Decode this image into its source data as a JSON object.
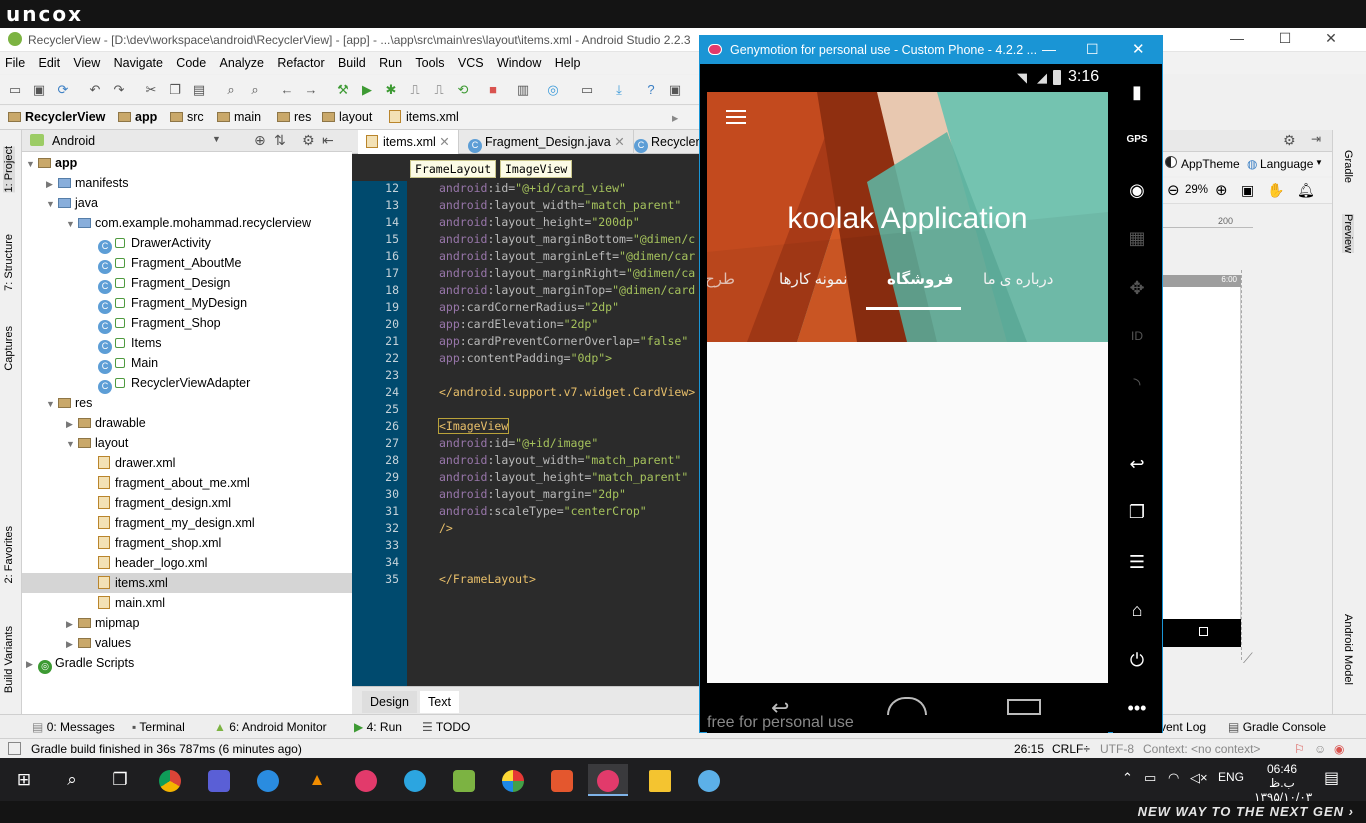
{
  "banner": {
    "logo": "uncox",
    "tagline": "NEW WAY TO THE NEXT GEN ›"
  },
  "window": {
    "title": "RecyclerView - [D:\\dev\\workspace\\android\\RecyclerView] - [app] - ...\\app\\src\\main\\res\\layout\\items.xml - Android Studio 2.2.3"
  },
  "menu": [
    "File",
    "Edit",
    "View",
    "Navigate",
    "Code",
    "Analyze",
    "Refactor",
    "Build",
    "Run",
    "Tools",
    "VCS",
    "Window",
    "Help"
  ],
  "nav": {
    "crumbs": [
      "RecyclerView",
      "app",
      "src",
      "main",
      "res",
      "layout",
      "items.xml"
    ]
  },
  "project": {
    "view_selector": "Android",
    "tree": [
      {
        "label": "app",
        "level": 0,
        "kind": "module"
      },
      {
        "label": "manifests",
        "level": 1,
        "kind": "folder"
      },
      {
        "label": "java",
        "level": 1,
        "kind": "folder"
      },
      {
        "label": "com.example.mohammad.recyclerview",
        "level": 2,
        "kind": "package"
      },
      {
        "label": "DrawerActivity",
        "level": 3,
        "kind": "class"
      },
      {
        "label": "Fragment_AboutMe",
        "level": 3,
        "kind": "class"
      },
      {
        "label": "Fragment_Design",
        "level": 3,
        "kind": "class"
      },
      {
        "label": "Fragment_MyDesign",
        "level": 3,
        "kind": "class"
      },
      {
        "label": "Fragment_Shop",
        "level": 3,
        "kind": "class"
      },
      {
        "label": "Items",
        "level": 3,
        "kind": "class"
      },
      {
        "label": "Main",
        "level": 3,
        "kind": "class"
      },
      {
        "label": "RecyclerViewAdapter",
        "level": 3,
        "kind": "class"
      },
      {
        "label": "res",
        "level": 1,
        "kind": "folder"
      },
      {
        "label": "drawable",
        "level": 2,
        "kind": "folder"
      },
      {
        "label": "layout",
        "level": 2,
        "kind": "folder"
      },
      {
        "label": "drawer.xml",
        "level": 3,
        "kind": "xml"
      },
      {
        "label": "fragment_about_me.xml",
        "level": 3,
        "kind": "xml"
      },
      {
        "label": "fragment_design.xml",
        "level": 3,
        "kind": "xml"
      },
      {
        "label": "fragment_my_design.xml",
        "level": 3,
        "kind": "xml"
      },
      {
        "label": "fragment_shop.xml",
        "level": 3,
        "kind": "xml"
      },
      {
        "label": "header_logo.xml",
        "level": 3,
        "kind": "xml"
      },
      {
        "label": "items.xml",
        "level": 3,
        "kind": "xml",
        "selected": true
      },
      {
        "label": "main.xml",
        "level": 3,
        "kind": "xml"
      },
      {
        "label": "mipmap",
        "level": 2,
        "kind": "folder"
      },
      {
        "label": "values",
        "level": 2,
        "kind": "folder"
      },
      {
        "label": "Gradle Scripts",
        "level": 0,
        "kind": "gradle"
      }
    ]
  },
  "editor": {
    "tabs": [
      "items.xml",
      "Fragment_Design.java",
      "RecyclerV"
    ],
    "breadcrumbs": [
      "FrameLayout",
      "ImageView"
    ],
    "lines": [
      {
        "n": "12",
        "ns": "android",
        "attr": ":id=",
        "val": "\"@+id/card_view\""
      },
      {
        "n": "13",
        "ns": "android",
        "attr": ":layout_width=",
        "val": "\"match_parent\""
      },
      {
        "n": "14",
        "ns": "android",
        "attr": ":layout_height=",
        "val": "\"200dp\""
      },
      {
        "n": "15",
        "ns": "android",
        "attr": ":layout_marginBottom=",
        "val": "\"@dimen/c"
      },
      {
        "n": "16",
        "ns": "android",
        "attr": ":layout_marginLeft=",
        "val": "\"@dimen/car"
      },
      {
        "n": "17",
        "ns": "android",
        "attr": ":layout_marginRight=",
        "val": "\"@dimen/ca"
      },
      {
        "n": "18",
        "ns": "android",
        "attr": ":layout_marginTop=",
        "val": "\"@dimen/card"
      },
      {
        "n": "19",
        "ns": "app",
        "attr": ":cardCornerRadius=",
        "val": "\"2dp\""
      },
      {
        "n": "20",
        "ns": "app",
        "attr": ":cardElevation=",
        "val": "\"2dp\""
      },
      {
        "n": "21",
        "ns": "app",
        "attr": ":cardPreventCornerOverlap=",
        "val": "\"false\""
      },
      {
        "n": "22",
        "ns": "app",
        "attr": ":contentPadding=",
        "val": "\"0dp\">"
      },
      {
        "n": "23",
        "raw": ""
      },
      {
        "n": "24",
        "raw": "</android.support.v7.widget.CardView>"
      },
      {
        "n": "25",
        "raw": ""
      },
      {
        "n": "26",
        "raw": "<ImageView"
      },
      {
        "n": "27",
        "ns": "android",
        "attr": ":id=",
        "val": "\"@+id/image\""
      },
      {
        "n": "28",
        "ns": "android",
        "attr": ":layout_width=",
        "val": "\"match_parent\""
      },
      {
        "n": "29",
        "ns": "android",
        "attr": ":layout_height=",
        "val": "\"match_parent\""
      },
      {
        "n": "30",
        "ns": "android",
        "attr": ":layout_margin=",
        "val": "\"2dp\""
      },
      {
        "n": "31",
        "ns": "android",
        "attr": ":scaleType=",
        "val": "\"centerCrop\""
      },
      {
        "n": "32",
        "raw": "/>"
      },
      {
        "n": "33",
        "raw": ""
      },
      {
        "n": "34",
        "raw": ""
      },
      {
        "n": "35",
        "raw": "</FrameLayout>"
      }
    ],
    "bottom_tabs": [
      "Design",
      "Text"
    ]
  },
  "left_stripe": [
    "1: Project",
    "7: Structure",
    "Captures",
    "2: Favorites",
    "Build Variants"
  ],
  "right_stripe": [
    "Gradle",
    "Preview",
    "Android Model"
  ],
  "preview": {
    "theme": "AppTheme",
    "language": "Language",
    "zoom": "29%",
    "ruler": "200",
    "time": "6:00"
  },
  "tool_windows": [
    "0: Messages",
    "Terminal",
    "6: Android Monitor",
    "4: Run",
    "TODO",
    "Event Log",
    "Gradle Console"
  ],
  "status": {
    "message": "Gradle build finished in 36s 787ms (6 minutes ago)",
    "position": "26:15",
    "line_sep": "CRLF÷",
    "encoding": "UTF-8",
    "context": "Context: <no context>"
  },
  "genymotion": {
    "title": "Genymotion for personal use - Custom Phone - 4.2.2 ...",
    "clock": "3:16",
    "app_title": "koolak Application",
    "tabs": [
      "درباره ی ما",
      "فروشگاه",
      "نمونه کارها",
      "طرح"
    ],
    "active_tab": "فروشگاه",
    "watermark": "free for personal use",
    "side_buttons": [
      "battery-icon",
      "gps-icon",
      "camera-icon",
      "clapper-icon",
      "dpad-icon",
      "id-icon",
      "rss-icon",
      "back-icon",
      "recent-icon",
      "menu-icon",
      "home-icon",
      "power-icon",
      "more-icon"
    ]
  },
  "taskbar": {
    "lang": "ENG",
    "time": "06:46 ب.ظ",
    "date": "۱۳۹۵/۱۰/۰۳"
  },
  "colors": {
    "accent": "#1a95d5",
    "editor_bg": "#2b2b2b",
    "gutter": "#004a6e",
    "appbar_teal": "#74c3b0",
    "appbar_orange": "#c0461c"
  }
}
